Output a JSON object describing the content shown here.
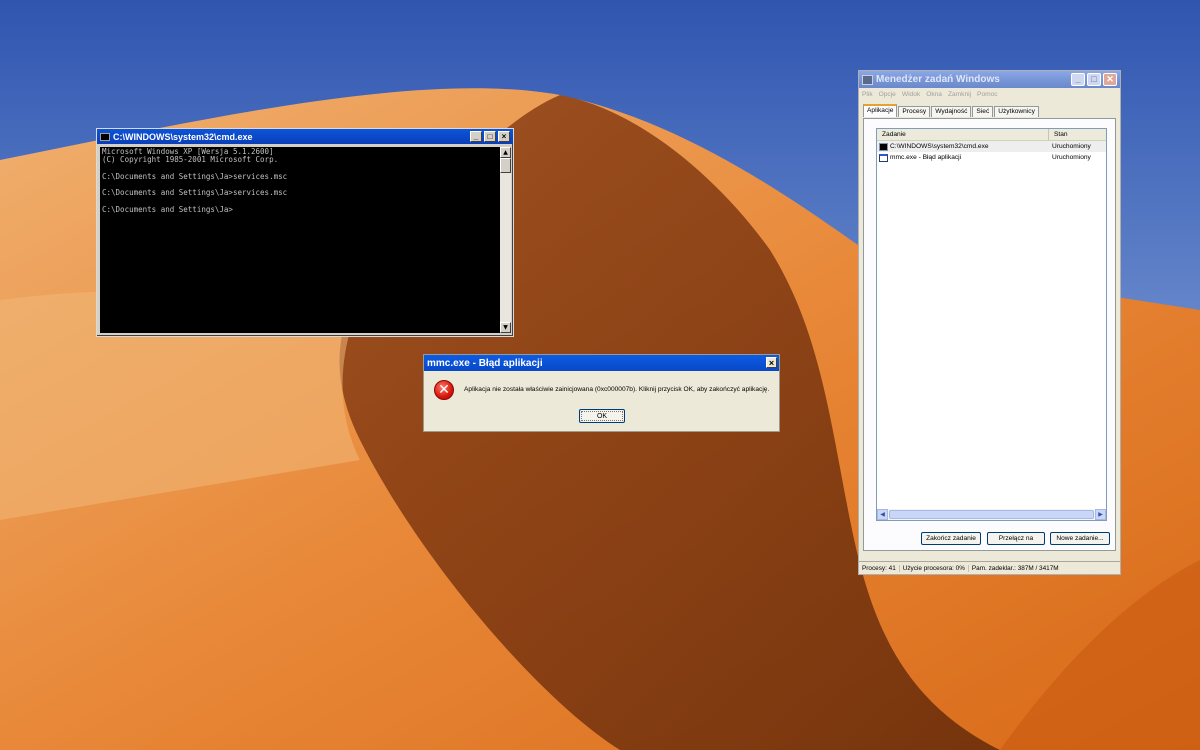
{
  "cmd_window": {
    "title": "C:\\WINDOWS\\system32\\cmd.exe",
    "console_text": "Microsoft Windows XP [Wersja 5.1.2600]\n(C) Copyright 1985-2001 Microsoft Corp.\n\nC:\\Documents and Settings\\Ja>services.msc\n\nC:\\Documents and Settings\\Ja>services.msc\n\nC:\\Documents and Settings\\Ja>",
    "min_glyph": "_",
    "max_glyph": "□",
    "close_glyph": "×"
  },
  "error_dialog": {
    "title": "mmc.exe - Błąd aplikacji",
    "message": "Aplikacja nie została właściwie zainicjowana (0xc000007b). Kliknij przycisk OK, aby zakończyć aplikację.",
    "ok_label": "OK",
    "close_glyph": "×",
    "icon_glyph": "✕"
  },
  "task_manager": {
    "title": "Menedżer zadań Windows",
    "menu": [
      "Plik",
      "Opcje",
      "Widok",
      "Okna",
      "Zamknij",
      "Pomoc"
    ],
    "tabs": [
      "Aplikacje",
      "Procesy",
      "Wydajność",
      "Sieć",
      "Użytkownicy"
    ],
    "active_tab": "Aplikacje",
    "columns": [
      "Zadanie",
      "Stan"
    ],
    "rows": [
      {
        "task": "C:\\WINDOWS\\system32\\cmd.exe",
        "status": "Uruchomiony",
        "icon": "cmd-icon"
      },
      {
        "task": "mmc.exe - Błąd aplikacji",
        "status": "Uruchomiony",
        "icon": "window-icon"
      }
    ],
    "buttons": {
      "end_task": "Zakończ zadanie",
      "switch_to": "Przełącz na",
      "new_task": "Nowe zadanie..."
    },
    "status": {
      "processes": "Procesy: 41",
      "cpu": "Użycie procesora: 0%",
      "commit": "Pam. zadeklar.: 387M / 3417M"
    }
  },
  "colors": {
    "titlebar_active": "#0a4fd0",
    "sky_top": "#3d63b8",
    "dune": "#e07a28",
    "error_red": "#d8160c"
  }
}
